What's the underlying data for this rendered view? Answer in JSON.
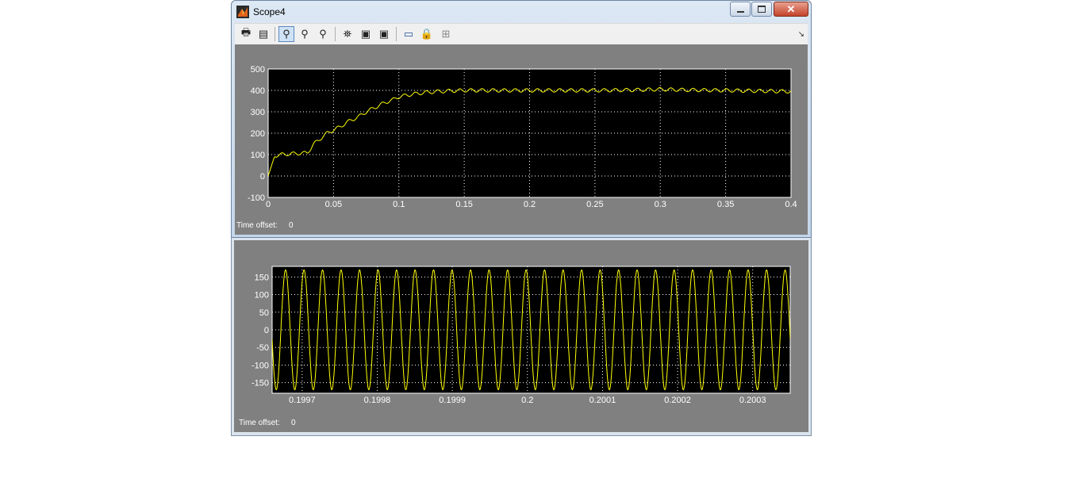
{
  "window": {
    "title": "Scope4",
    "controls": {
      "minimize": "minimize",
      "maximize": "maximize",
      "close": "close"
    }
  },
  "toolbar": {
    "items": [
      {
        "icon": "print-icon"
      },
      {
        "icon": "parameters-icon"
      },
      {
        "icon": "zoom-icon",
        "pressed": true
      },
      {
        "icon": "zoom-x-icon"
      },
      {
        "icon": "zoom-y-icon"
      },
      {
        "icon": "autoscale-icon"
      },
      {
        "icon": "save-axes-icon"
      },
      {
        "icon": "restore-axes-icon"
      },
      {
        "icon": "floating-scope-icon"
      },
      {
        "icon": "lock-axes-icon"
      },
      {
        "icon": "signal-selector-icon"
      }
    ]
  },
  "colors": {
    "trace": "#ffff00",
    "plot_bg": "#000000",
    "frame_bg": "#808080",
    "grid": "#ffffff",
    "tick_text": "#ffffff"
  },
  "scope1": {
    "time_offset_label": "Time offset:",
    "time_offset_value": "0"
  },
  "scope2": {
    "time_offset_label": "Time offset:",
    "time_offset_value": "0"
  },
  "chart_data": [
    {
      "type": "line",
      "title": "",
      "xlabel": "",
      "ylabel": "",
      "xlim": [
        0,
        0.4
      ],
      "ylim": [
        -100,
        500
      ],
      "xticks": [
        0,
        0.05,
        0.1,
        0.15,
        0.2,
        0.25,
        0.3,
        0.35,
        0.4
      ],
      "xtick_labels": [
        "0",
        "0.05",
        "0.1",
        "0.15",
        "0.2",
        "0.25",
        "0.3",
        "0.35",
        "0.4"
      ],
      "yticks": [
        -100,
        0,
        100,
        200,
        300,
        400,
        500
      ],
      "ytick_labels": [
        "-100",
        "0",
        "100",
        "200",
        "300",
        "400",
        "500"
      ],
      "grid": true,
      "series": [
        {
          "x": [
            0,
            0.005,
            0.01,
            0.02,
            0.03,
            0.035,
            0.04,
            0.045,
            0.05,
            0.055,
            0.06,
            0.065,
            0.07,
            0.075,
            0.08,
            0.085,
            0.09,
            0.095,
            0.1,
            0.11,
            0.12,
            0.13,
            0.14,
            0.15,
            0.17,
            0.2,
            0.25,
            0.28,
            0.3,
            0.32,
            0.35,
            0.37,
            0.4
          ],
          "y": [
            0,
            95,
            100,
            105,
            108,
            150,
            175,
            200,
            215,
            230,
            250,
            265,
            280,
            300,
            315,
            330,
            345,
            355,
            370,
            382,
            390,
            395,
            398,
            400,
            400,
            400,
            400,
            402,
            405,
            402,
            400,
            398,
            395
          ],
          "ripple_amplitude": 8
        }
      ]
    },
    {
      "type": "line",
      "title": "",
      "xlabel": "",
      "ylabel": "",
      "xlim": [
        0.19966,
        0.20035
      ],
      "ylim": [
        -180,
        180
      ],
      "xticks": [
        0.1997,
        0.1998,
        0.1999,
        0.2,
        0.2001,
        0.2002,
        0.2003
      ],
      "xtick_labels": [
        "0.1997",
        "0.1998",
        "0.1999",
        "0.2",
        "0.2001",
        "0.2002",
        "0.2003"
      ],
      "yticks": [
        -150,
        -100,
        -50,
        0,
        50,
        100,
        150
      ],
      "ytick_labels": [
        "-150",
        "-100",
        "-50",
        "0",
        "50",
        "100",
        "150"
      ],
      "grid": true,
      "series": [
        {
          "waveform": "sine",
          "amplitude": 170,
          "cycles": 28
        }
      ]
    }
  ]
}
